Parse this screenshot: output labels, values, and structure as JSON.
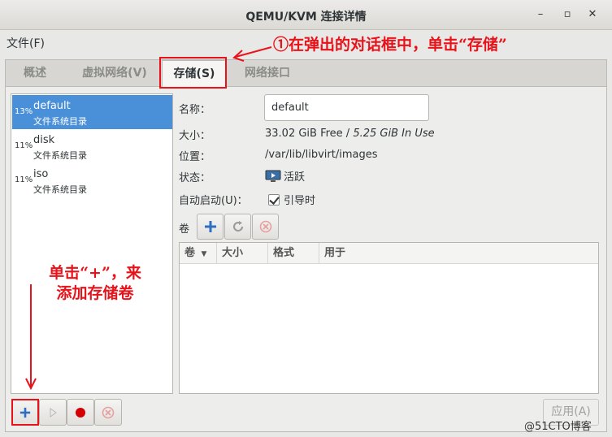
{
  "window": {
    "title": "QEMU/KVM 连接详情",
    "minimize": "–",
    "maximize": "▫",
    "close": "✕"
  },
  "menu": {
    "file": "文件(F)"
  },
  "annotations": {
    "top": "①在弹出的对话框中，单击“存储”",
    "left_line1": "单击“+”，来",
    "left_line2": "添加存储卷"
  },
  "tabs": [
    {
      "label": "概述"
    },
    {
      "label": "虚拟网络(V)"
    },
    {
      "label": "存储(S)"
    },
    {
      "label": "网络接口"
    }
  ],
  "pools": [
    {
      "pct": "13%",
      "name": "default",
      "type": "文件系统目录"
    },
    {
      "pct": "11%",
      "name": "disk",
      "type": "文件系统目录"
    },
    {
      "pct": "11%",
      "name": "iso",
      "type": "文件系统目录"
    }
  ],
  "details": {
    "name_label": "名称：",
    "name_value": "default",
    "size_label": "大小：",
    "size_free": "33.02 GiB Free",
    "size_sep": " / ",
    "size_used": "5.25 GiB In Use",
    "location_label": "位置：",
    "location_value": "/var/lib/libvirt/images",
    "state_label": "状态：",
    "state_value": "活跃",
    "autostart_label": "自动启动(U)：",
    "autostart_value": "引导时"
  },
  "volumes": {
    "label": "卷",
    "columns": [
      "卷",
      "大小",
      "格式",
      "用于"
    ]
  },
  "buttons": {
    "apply": "应用(A)"
  },
  "watermark": "@51CTO博客",
  "colors": {
    "accent": "#4a90d9",
    "annotation": "#e8131a",
    "add": "#2f6fbf",
    "stop": "#d40000"
  }
}
